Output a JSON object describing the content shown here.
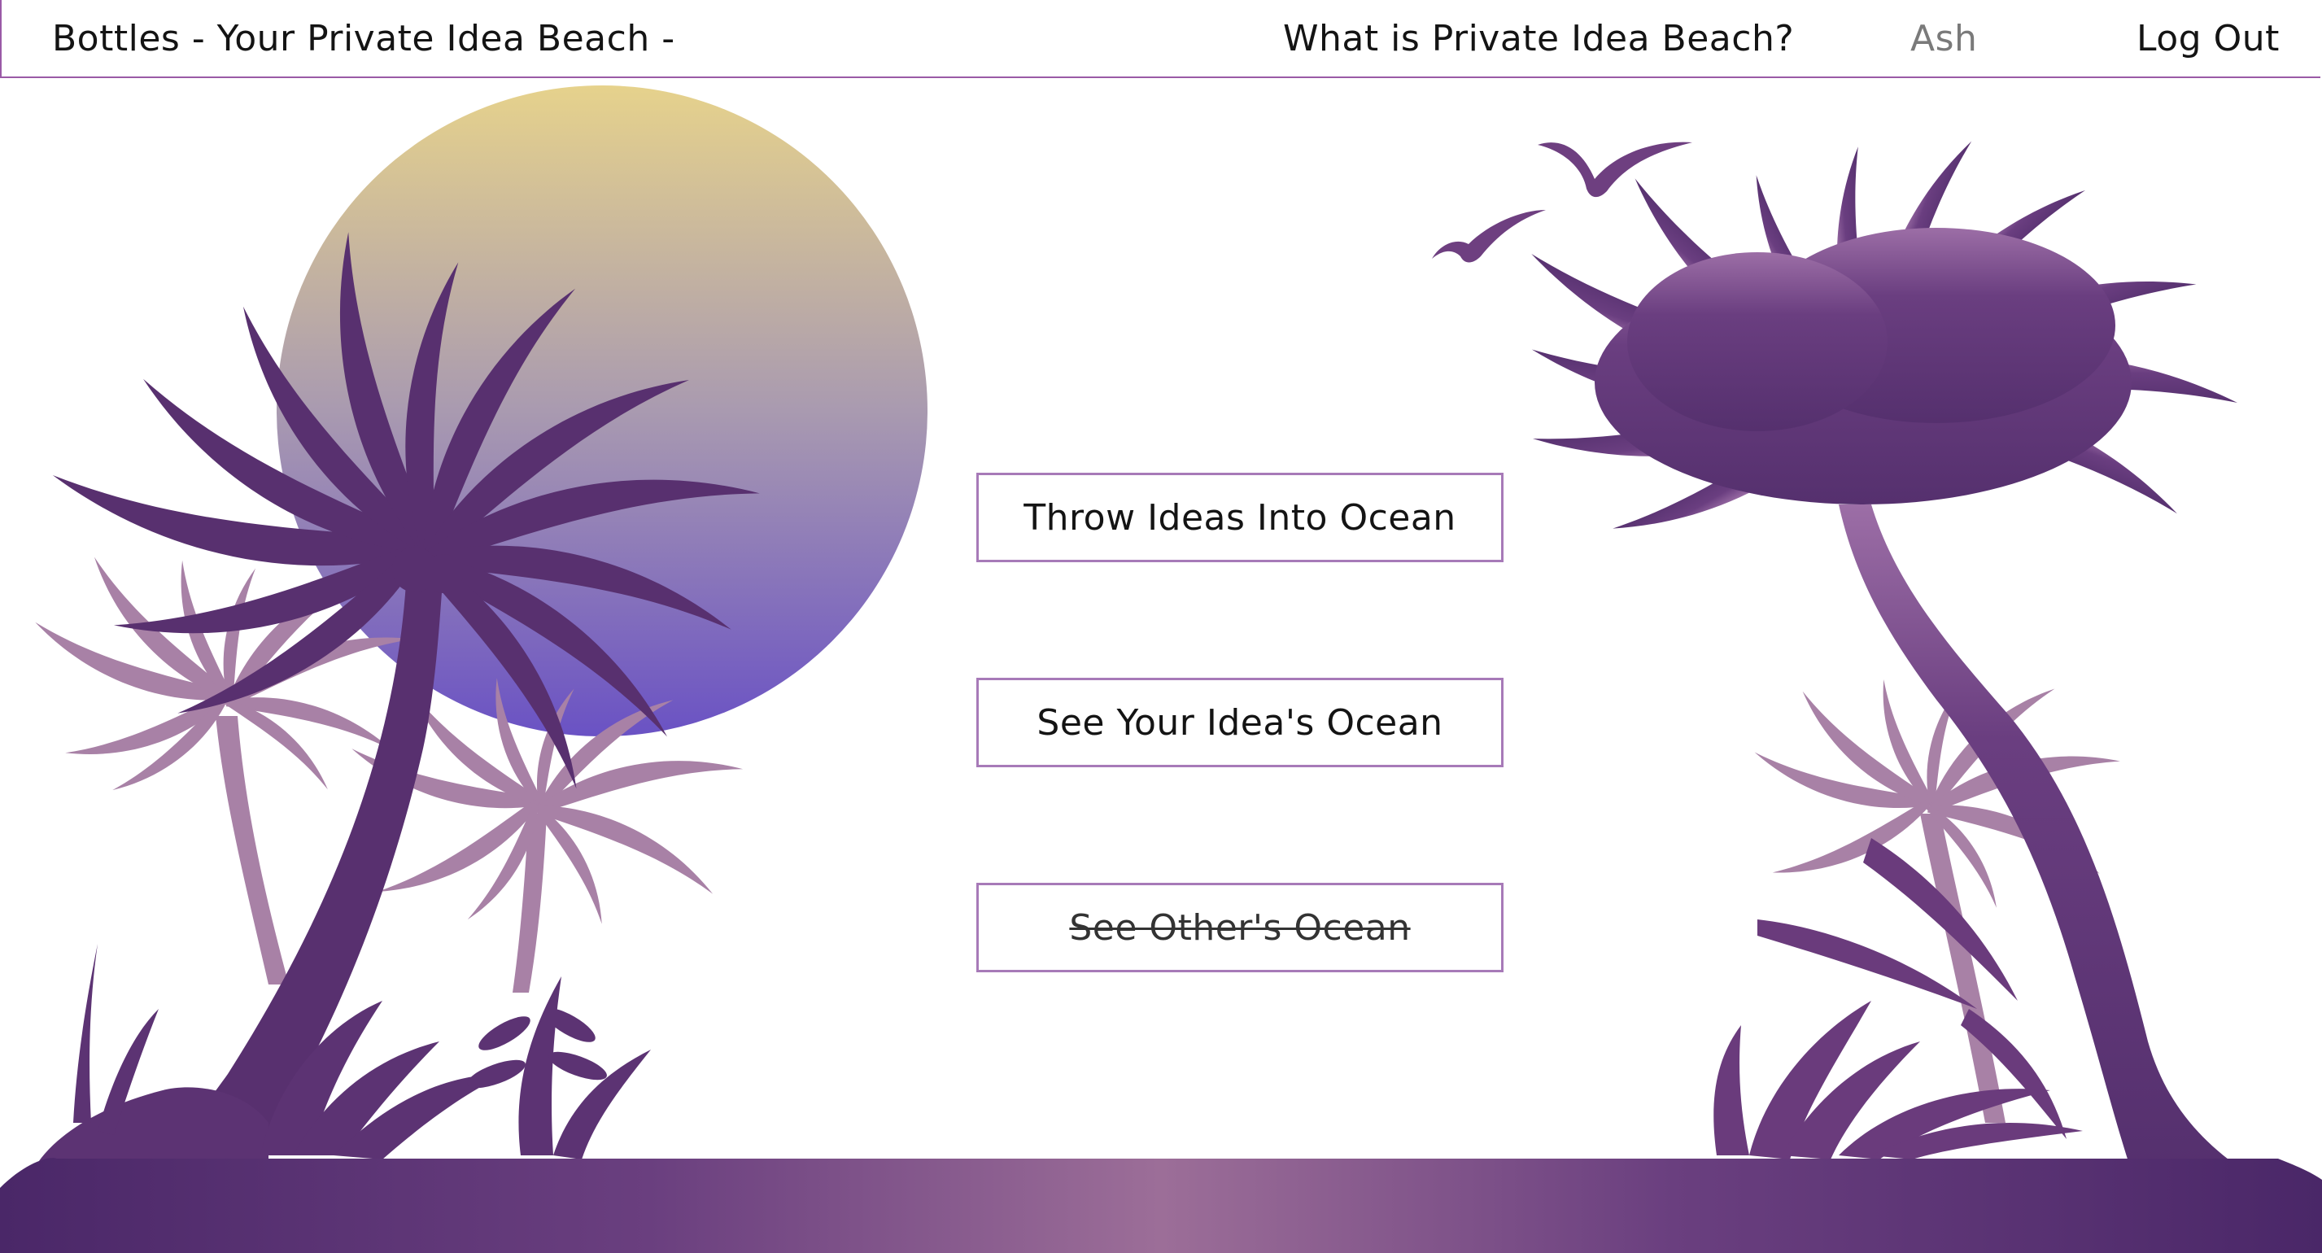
{
  "header": {
    "title": "Bottles - Your Private Idea Beach -",
    "about_link": "What is Private Idea Beach?",
    "username": "Ash",
    "logout": "Log Out"
  },
  "main": {
    "throw_button": "Throw Ideas Into Ocean",
    "see_own_button": "See Your Idea's Ocean",
    "see_others_button": "See Other's Ocean"
  },
  "colors": {
    "palm_dark": "#58306f",
    "palm_light": "#a881a6",
    "sun_top": "#e6d28c",
    "sun_bottom": "#6b55c6",
    "nav_border": "#9a5aa6",
    "button_border": "#a77ab8"
  }
}
